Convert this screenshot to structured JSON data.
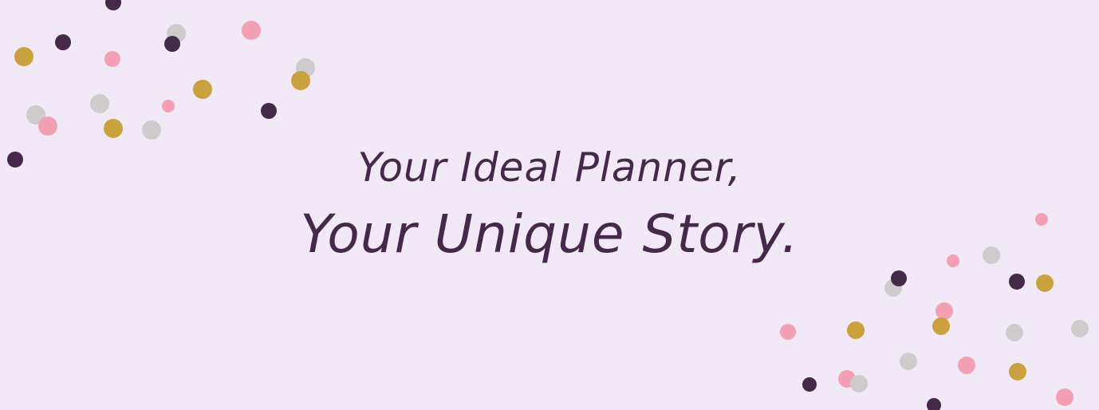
{
  "banner": {
    "headline_line1": "Your Ideal Planner,",
    "headline_line2": "Your Unique Story."
  },
  "colors": {
    "background": "#f1e9f5",
    "text": "#45294a",
    "dot_dark": "#45294a",
    "dot_gold": "#c9a23f",
    "dot_pink": "#f3a0b4",
    "dot_gray": "#cfcbcc"
  },
  "icons": {
    "decoration": "confetti-dot-icon"
  }
}
